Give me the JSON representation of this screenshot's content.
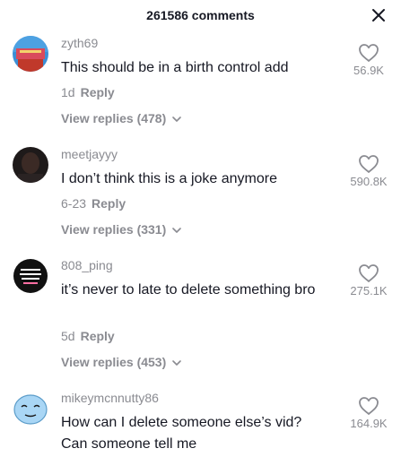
{
  "header": {
    "title": "261586 comments",
    "close_icon": "close-icon"
  },
  "comments": [
    {
      "username": "zyth69",
      "text": "This should be in a birth control add",
      "date": "1d",
      "reply_label": "Reply",
      "view_replies": "View replies (478)",
      "likes": "56.9K",
      "avatar_colors": [
        "#d94b5c",
        "#3c8fd6"
      ]
    },
    {
      "username": "meetjayyy",
      "text": "I don’t think this is a joke anymore",
      "date": "6-23",
      "reply_label": "Reply",
      "view_replies": "View replies (331)",
      "likes": "590.8K",
      "avatar_colors": [
        "#3b2a25",
        "#1e1a1a"
      ]
    },
    {
      "username": "808_ping",
      "text": "it’s never to late to delete something bro",
      "date": "5d",
      "reply_label": "Reply",
      "view_replies": "View replies (453)",
      "likes": "275.1K",
      "avatar_colors": [
        "#111111",
        "#ffffff"
      ]
    },
    {
      "username": "mikeymcnnutty86",
      "text": "How can I delete someone else’s vid? Can someone tell me",
      "likes": "164.9K",
      "avatar_colors": [
        "#a9d6f5",
        "#ffffff"
      ]
    }
  ]
}
